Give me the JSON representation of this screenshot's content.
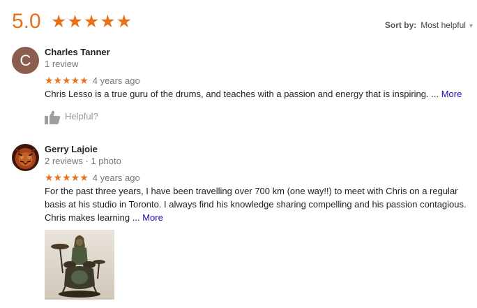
{
  "summary": {
    "rating": "5.0",
    "stars": "★★★★★",
    "sort_label": "Sort by:",
    "sort_value": "Most helpful"
  },
  "colors": {
    "star": "#e7711b",
    "link": "#1a0dab"
  },
  "reviews": [
    {
      "avatar_letter": "C",
      "name": "Charles Tanner",
      "meta": "1 review",
      "stars": "★★★★★",
      "time": "4 years ago",
      "text": "Chris Lesso is a true guru of the drums, and teaches with a passion and energy that is inspiring. ...",
      "more": "More",
      "helpful": "Helpful?"
    },
    {
      "avatar_icon": "tiger-face-avatar",
      "name": "Gerry Lajoie",
      "meta": "2 reviews · 1 photo",
      "stars": "★★★★★",
      "time": "4 years ago",
      "text": "For the past three years, I have been travelling over 700 km (one way!!) to meet with Chris on a regular basis at his studio in Toronto. I always find his knowledge sharing compelling and his passion contagious. Chris makes learning ...",
      "more": "More",
      "photo_icon": "drum-kit-figurine-photo"
    }
  ]
}
